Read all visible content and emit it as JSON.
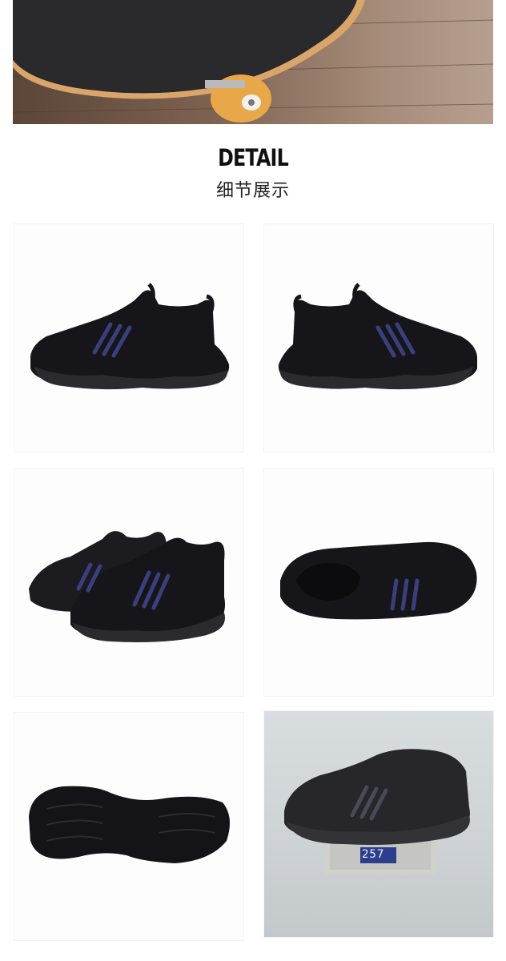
{
  "section": {
    "title_en": "DETAIL",
    "title_cn": "细节展示"
  },
  "hero": {
    "subject": "skateboard-on-wood-floor"
  },
  "gallery": [
    {
      "view": "side-profile-left"
    },
    {
      "view": "side-profile-right"
    },
    {
      "view": "pair-three-quarter"
    },
    {
      "view": "top-down-interior"
    },
    {
      "view": "outsole-bottom"
    },
    {
      "view": "on-scale",
      "scale_reading": "257"
    }
  ],
  "colors": {
    "shoe": "#16161a",
    "stripe_accent": "#3a3f7e",
    "sole": "#2b2b2f"
  }
}
